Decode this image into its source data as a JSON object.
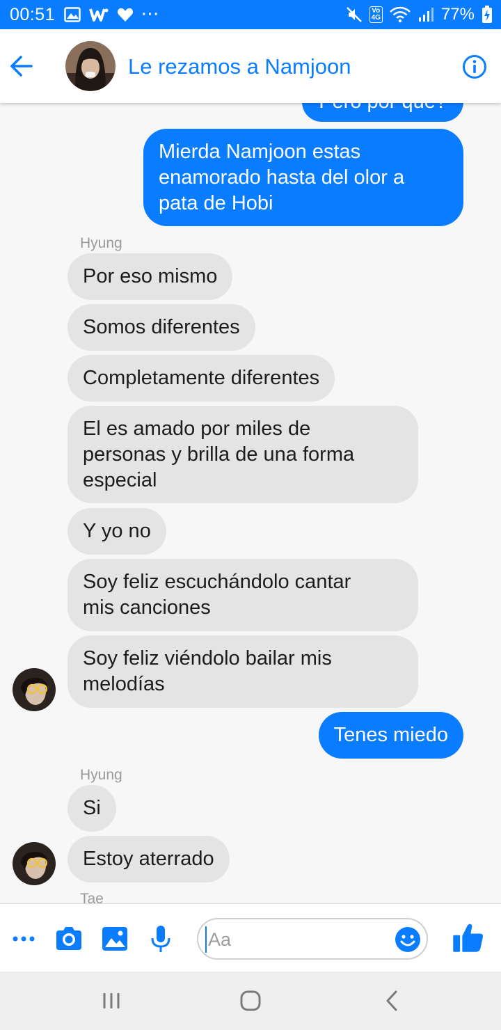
{
  "status_bar": {
    "time": "00:51",
    "battery": "77%",
    "network_label_top": "Vo",
    "network_label_bottom": "4G",
    "more": "···",
    "left_icons": [
      "gallery-icon",
      "w-app-icon",
      "heart-icon"
    ],
    "right_icons": [
      "mute-icon",
      "volte-icon",
      "wifi-icon",
      "signal-icon",
      "battery-icon"
    ]
  },
  "header": {
    "title": "Le rezamos a Namjoon",
    "back_icon": "back-arrow-icon",
    "info_icon": "info-icon"
  },
  "messages": {
    "partial_top": "Pero por qué?",
    "m1": [
      "Mierda Namjoon estas",
      "enamorado hasta del olor a",
      "pata de Hobi"
    ],
    "sender1": "Hyung",
    "m2": "Por eso mismo",
    "m3": "Somos diferentes",
    "m4": "Completamente diferentes",
    "m5": [
      "El es amado por miles de",
      "personas y brilla de una forma",
      "especial"
    ],
    "m6": "Y yo no",
    "m7": [
      "Soy feliz escuchándolo cantar",
      "mis canciones"
    ],
    "m8": [
      "Soy feliz viéndolo bailar mis",
      "melodías"
    ],
    "m9": "Tenes miedo",
    "sender2": "Hyung",
    "m10": "Si",
    "m11": "Estoy aterrado",
    "sender3_partial": "Tae"
  },
  "composer": {
    "placeholder": "Aa",
    "icons": [
      "more-icon",
      "camera-icon",
      "image-icon",
      "microphone-icon",
      "emoji-icon",
      "thumbs-up-icon"
    ]
  },
  "nav": {
    "icons": [
      "recent-apps-icon",
      "home-icon",
      "back-icon"
    ]
  },
  "colors": {
    "accent": "#0a7cff",
    "incoming_bubble": "#e4e4e4",
    "background": "#f7f7f7"
  }
}
